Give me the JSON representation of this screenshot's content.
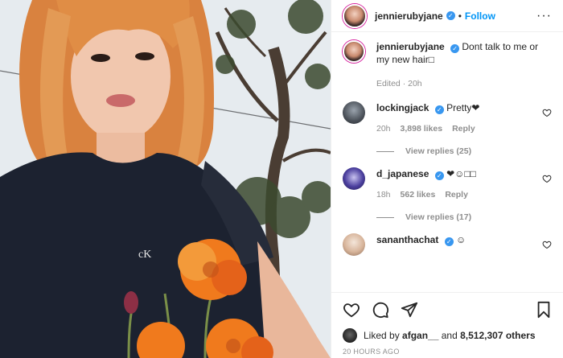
{
  "post": {
    "author": "jennierubyjane",
    "follow_label": "Follow",
    "separator": "•",
    "more": "···",
    "photo_logo": "cK"
  },
  "caption": {
    "author": "jennierubyjane",
    "text": "Dont talk to me or my new hair□",
    "edited": "Edited · 20h"
  },
  "comments": [
    {
      "user": "lockingjack",
      "text": "Pretty❤",
      "time": "20h",
      "likes": "3,898 likes",
      "reply": "Reply",
      "view_replies": "View replies (25)"
    },
    {
      "user": "d_japanese",
      "text": "❤☺□□",
      "time": "18h",
      "likes": "562 likes",
      "reply": "Reply",
      "view_replies": "View replies (17)"
    },
    {
      "user": "sananthachat",
      "text": "☺"
    }
  ],
  "footer": {
    "liked_prefix": "Liked by",
    "liked_user": "afgan__",
    "liked_and": "and",
    "liked_count": "8,512,307 others",
    "timestamp": "20 HOURS AGO"
  },
  "colors": {
    "accent": "#0095f6",
    "verified": "#3897f0",
    "muted": "#8e8e8e"
  },
  "icons": [
    "verified-icon",
    "heart-icon",
    "comment-icon",
    "share-icon",
    "bookmark-icon",
    "more-icon"
  ]
}
